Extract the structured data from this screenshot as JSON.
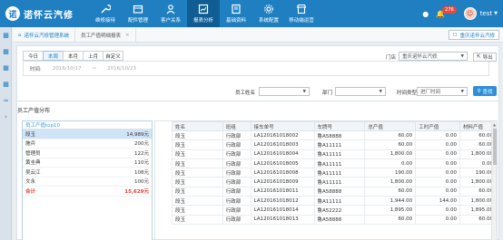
{
  "app": {
    "logo_mark": "诺",
    "logo_text": "诺怀云汽修"
  },
  "nav": [
    {
      "label": "维修接待",
      "icon": "wrench-icon",
      "active": false
    },
    {
      "label": "配件管理",
      "icon": "box-icon",
      "active": false
    },
    {
      "label": "客户关系",
      "icon": "users-icon",
      "active": false
    },
    {
      "label": "报表分析",
      "icon": "chart-icon",
      "active": true
    },
    {
      "label": "基础资料",
      "icon": "book-icon",
      "active": false
    },
    {
      "label": "系统配置",
      "icon": "gear-icon",
      "active": false
    },
    {
      "label": "移动端运营",
      "icon": "store-icon",
      "active": false
    }
  ],
  "header_right": {
    "notification_count": "276",
    "username": "test"
  },
  "breadcrumb": {
    "tabs": [
      {
        "label": "诺怀云汽修管理系统"
      },
      {
        "label": "员工产值明细报表"
      }
    ],
    "store_button": "重庆诺怀云汽修"
  },
  "filters": {
    "tabs": [
      "今日",
      "本周",
      "本月",
      "上月",
      "自定义"
    ],
    "active_tab": "本周",
    "time_label": "时间:",
    "date_from": "2016/10/17",
    "date_to": "2016/10/23",
    "store_label": "门店",
    "store_value": "重庆诺怀云汽修",
    "export_label": "导出",
    "employee_label": "员工姓名",
    "department_label": "部门",
    "time_type_label": "时间类型",
    "time_type_value": "进厂时间",
    "search_label": "查找"
  },
  "stats": {
    "title": "员工产值分布",
    "header": "员工产值top10",
    "rows": [
      {
        "name": "段玉",
        "value": "14,989元"
      },
      {
        "name": "施兵",
        "value": "200元"
      },
      {
        "name": "管理员",
        "value": "122元"
      },
      {
        "name": "黄圭典",
        "value": "110元"
      },
      {
        "name": "吴云江",
        "value": "108元"
      },
      {
        "name": "文永",
        "value": "100元"
      }
    ],
    "total_label": "合计",
    "total_value": "15,629元"
  },
  "table": {
    "columns": [
      "姓名",
      "班组",
      "接车单号",
      "车牌号",
      "总产值",
      "工时产值",
      "材料产值"
    ],
    "rows": [
      [
        "段玉",
        "行政部",
        "LA120161018002",
        "鲁A58888",
        "60.00",
        "0.00",
        "60.00"
      ],
      [
        "段玉",
        "行政部",
        "LA120161018003",
        "鲁A11111",
        "60.00",
        "0.00",
        "60.00"
      ],
      [
        "段玉",
        "行政部",
        "LA120161018004",
        "鲁A11111",
        "1,800.00",
        "0.00",
        "1,800.00"
      ],
      [
        "段玉",
        "行政部",
        "LA120161018005",
        "鲁A11111",
        "0.00",
        "0.00",
        "0.00"
      ],
      [
        "段玉",
        "行政部",
        "LA120161018008",
        "鲁A11111",
        "190.00",
        "0.00",
        "190.00"
      ],
      [
        "段玉",
        "行政部",
        "LA120161018009",
        "鲁A11111",
        "1,800.00",
        "0.00",
        "1,800.00"
      ],
      [
        "段玉",
        "行政部",
        "LA120161018011",
        "鲁A58888",
        "60.00",
        "0.00",
        "60.00"
      ],
      [
        "段玉",
        "行政部",
        "LA120161018012",
        "鲁A11111",
        "1,944.00",
        "144.00",
        "1,800.00"
      ],
      [
        "段玉",
        "行政部",
        "LA120161018014",
        "鲁A52222",
        "1,895.00",
        "0.00",
        "1,895.00"
      ],
      [
        "段玉",
        "行政部",
        "LA120161018013",
        "鲁A58888",
        "60.00",
        "0.00",
        "60.00"
      ]
    ]
  }
}
